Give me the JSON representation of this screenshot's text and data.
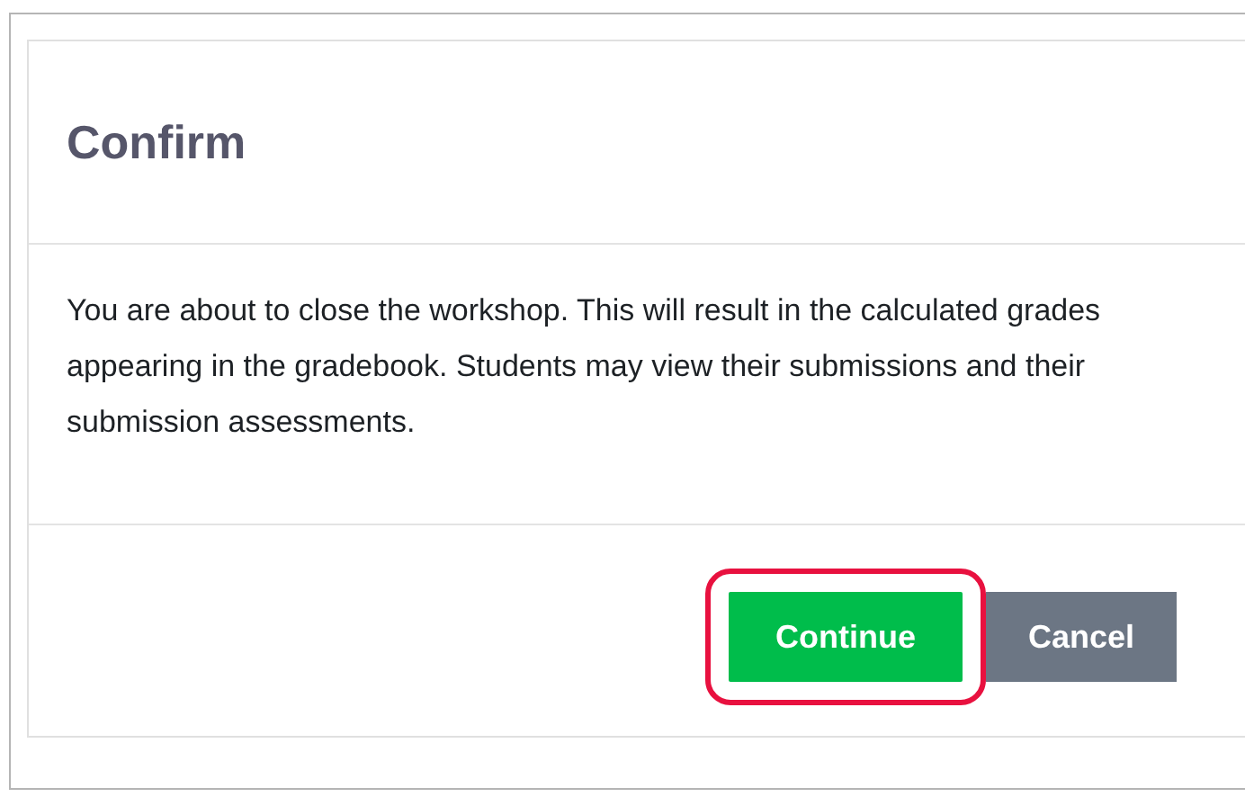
{
  "dialog": {
    "title": "Confirm",
    "message": "You are about to close the workshop. This will result in the calculated grades appearing in the gradebook. Students may view their submissions and their submission assessments.",
    "buttons": [
      {
        "label": "Continue",
        "kind": "primary",
        "highlighted": true
      },
      {
        "label": "Cancel",
        "kind": "secondary",
        "highlighted": false
      }
    ]
  }
}
